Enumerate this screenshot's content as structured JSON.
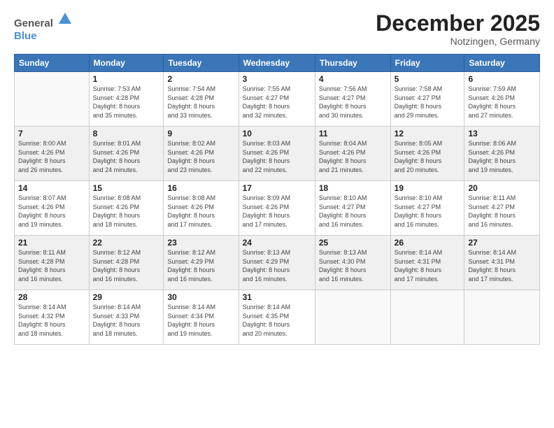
{
  "header": {
    "logo_general": "General",
    "logo_blue": "Blue",
    "month_title": "December 2025",
    "location": "Notzingen, Germany"
  },
  "weekdays": [
    "Sunday",
    "Monday",
    "Tuesday",
    "Wednesday",
    "Thursday",
    "Friday",
    "Saturday"
  ],
  "weeks": [
    [
      {
        "day": "",
        "info": ""
      },
      {
        "day": "1",
        "info": "Sunrise: 7:53 AM\nSunset: 4:28 PM\nDaylight: 8 hours\nand 35 minutes."
      },
      {
        "day": "2",
        "info": "Sunrise: 7:54 AM\nSunset: 4:28 PM\nDaylight: 8 hours\nand 33 minutes."
      },
      {
        "day": "3",
        "info": "Sunrise: 7:55 AM\nSunset: 4:27 PM\nDaylight: 8 hours\nand 32 minutes."
      },
      {
        "day": "4",
        "info": "Sunrise: 7:56 AM\nSunset: 4:27 PM\nDaylight: 8 hours\nand 30 minutes."
      },
      {
        "day": "5",
        "info": "Sunrise: 7:58 AM\nSunset: 4:27 PM\nDaylight: 8 hours\nand 29 minutes."
      },
      {
        "day": "6",
        "info": "Sunrise: 7:59 AM\nSunset: 4:26 PM\nDaylight: 8 hours\nand 27 minutes."
      }
    ],
    [
      {
        "day": "7",
        "info": "Sunrise: 8:00 AM\nSunset: 4:26 PM\nDaylight: 8 hours\nand 26 minutes."
      },
      {
        "day": "8",
        "info": "Sunrise: 8:01 AM\nSunset: 4:26 PM\nDaylight: 8 hours\nand 24 minutes."
      },
      {
        "day": "9",
        "info": "Sunrise: 8:02 AM\nSunset: 4:26 PM\nDaylight: 8 hours\nand 23 minutes."
      },
      {
        "day": "10",
        "info": "Sunrise: 8:03 AM\nSunset: 4:26 PM\nDaylight: 8 hours\nand 22 minutes."
      },
      {
        "day": "11",
        "info": "Sunrise: 8:04 AM\nSunset: 4:26 PM\nDaylight: 8 hours\nand 21 minutes."
      },
      {
        "day": "12",
        "info": "Sunrise: 8:05 AM\nSunset: 4:26 PM\nDaylight: 8 hours\nand 20 minutes."
      },
      {
        "day": "13",
        "info": "Sunrise: 8:06 AM\nSunset: 4:26 PM\nDaylight: 8 hours\nand 19 minutes."
      }
    ],
    [
      {
        "day": "14",
        "info": "Sunrise: 8:07 AM\nSunset: 4:26 PM\nDaylight: 8 hours\nand 19 minutes."
      },
      {
        "day": "15",
        "info": "Sunrise: 8:08 AM\nSunset: 4:26 PM\nDaylight: 8 hours\nand 18 minutes."
      },
      {
        "day": "16",
        "info": "Sunrise: 8:08 AM\nSunset: 4:26 PM\nDaylight: 8 hours\nand 17 minutes."
      },
      {
        "day": "17",
        "info": "Sunrise: 8:09 AM\nSunset: 4:26 PM\nDaylight: 8 hours\nand 17 minutes."
      },
      {
        "day": "18",
        "info": "Sunrise: 8:10 AM\nSunset: 4:27 PM\nDaylight: 8 hours\nand 16 minutes."
      },
      {
        "day": "19",
        "info": "Sunrise: 8:10 AM\nSunset: 4:27 PM\nDaylight: 8 hours\nand 16 minutes."
      },
      {
        "day": "20",
        "info": "Sunrise: 8:11 AM\nSunset: 4:27 PM\nDaylight: 8 hours\nand 16 minutes."
      }
    ],
    [
      {
        "day": "21",
        "info": "Sunrise: 8:11 AM\nSunset: 4:28 PM\nDaylight: 8 hours\nand 16 minutes."
      },
      {
        "day": "22",
        "info": "Sunrise: 8:12 AM\nSunset: 4:28 PM\nDaylight: 8 hours\nand 16 minutes."
      },
      {
        "day": "23",
        "info": "Sunrise: 8:12 AM\nSunset: 4:29 PM\nDaylight: 8 hours\nand 16 minutes."
      },
      {
        "day": "24",
        "info": "Sunrise: 8:13 AM\nSunset: 4:29 PM\nDaylight: 8 hours\nand 16 minutes."
      },
      {
        "day": "25",
        "info": "Sunrise: 8:13 AM\nSunset: 4:30 PM\nDaylight: 8 hours\nand 16 minutes."
      },
      {
        "day": "26",
        "info": "Sunrise: 8:14 AM\nSunset: 4:31 PM\nDaylight: 8 hours\nand 17 minutes."
      },
      {
        "day": "27",
        "info": "Sunrise: 8:14 AM\nSunset: 4:31 PM\nDaylight: 8 hours\nand 17 minutes."
      }
    ],
    [
      {
        "day": "28",
        "info": "Sunrise: 8:14 AM\nSunset: 4:32 PM\nDaylight: 8 hours\nand 18 minutes."
      },
      {
        "day": "29",
        "info": "Sunrise: 8:14 AM\nSunset: 4:33 PM\nDaylight: 8 hours\nand 18 minutes."
      },
      {
        "day": "30",
        "info": "Sunrise: 8:14 AM\nSunset: 4:34 PM\nDaylight: 8 hours\nand 19 minutes."
      },
      {
        "day": "31",
        "info": "Sunrise: 8:14 AM\nSunset: 4:35 PM\nDaylight: 8 hours\nand 20 minutes."
      },
      {
        "day": "",
        "info": ""
      },
      {
        "day": "",
        "info": ""
      },
      {
        "day": "",
        "info": ""
      }
    ]
  ]
}
